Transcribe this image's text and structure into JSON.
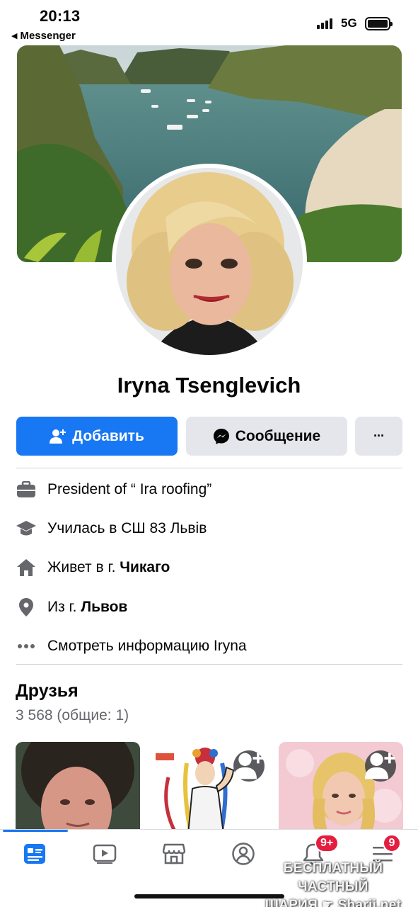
{
  "status_bar": {
    "time": "20:13",
    "back_app": "Messenger",
    "network": "5G"
  },
  "profile": {
    "name": "Iryna Tsenglevich",
    "actions": {
      "add_label": "Добавить",
      "message_label": "Сообщение",
      "more_label": "···"
    }
  },
  "intro": {
    "work": {
      "text": "President of “ Ira roofing”"
    },
    "education": {
      "text": "Училась в СШ 83 Львів"
    },
    "lives": {
      "prefix": "Живет в г. ",
      "place": "Чикаго"
    },
    "from": {
      "prefix": "Из г. ",
      "place": "Львов"
    },
    "see_more": {
      "text": "Смотреть информацию Iryna"
    }
  },
  "friends": {
    "title": "Друзья",
    "count": "3 568 (общие: 1)"
  },
  "tabbar": {
    "items": [
      "news-feed",
      "watch",
      "marketplace",
      "profile",
      "notifications",
      "menu"
    ],
    "notifications_badge": "9+",
    "menu_badge": "9"
  },
  "watermark": {
    "line1": "БЕСПЛАТНЫЙ ЧАСТНЫЙ",
    "line2": "ШАРИЯ",
    "line3": "Sharij.net"
  },
  "colors": {
    "accent": "#1877f2",
    "button_secondary": "#e4e6eb",
    "badge": "#e41e3f",
    "muted_text": "#65676b"
  }
}
